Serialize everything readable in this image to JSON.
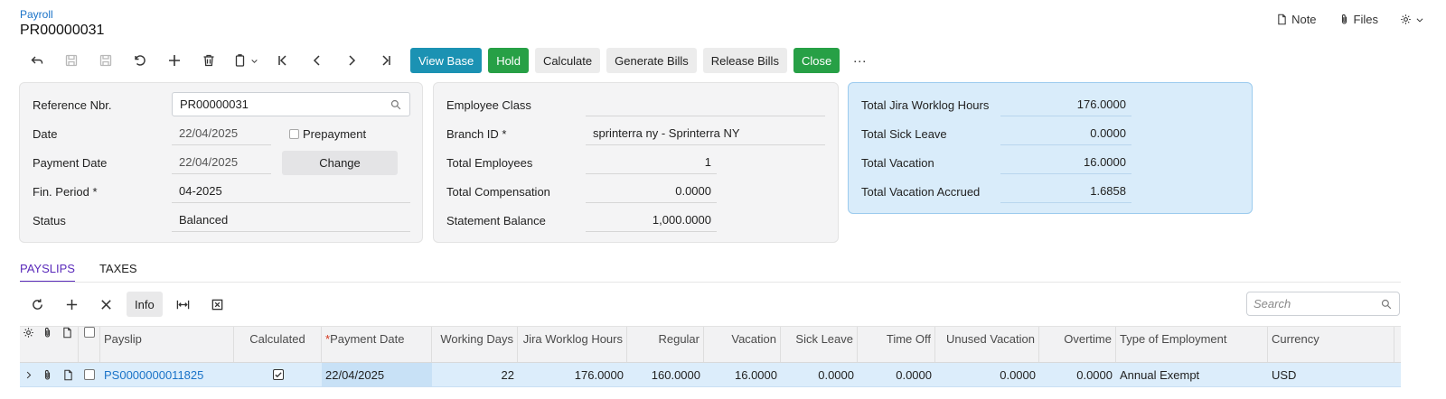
{
  "header": {
    "breadcrumb": "Payroll",
    "title": "PR00000031",
    "note_label": "Note",
    "files_label": "Files"
  },
  "toolbar": {
    "view_base": "View Base",
    "hold": "Hold",
    "calculate": "Calculate",
    "generate_bills": "Generate Bills",
    "release_bills": "Release Bills",
    "close": "Close",
    "more": "···"
  },
  "summary": {
    "reference_nbr_label": "Reference Nbr.",
    "reference_nbr": "PR00000031",
    "date_label": "Date",
    "date": "22/04/2025",
    "prepayment_label": "Prepayment",
    "payment_date_label": "Payment Date",
    "payment_date": "22/04/2025",
    "change_label": "Change",
    "fin_period_label": "Fin. Period",
    "fin_period": "04-2025",
    "status_label": "Status",
    "status": "Balanced"
  },
  "employee": {
    "employee_class_label": "Employee Class",
    "employee_class": "",
    "branch_id_label": "Branch ID",
    "branch_id": "sprinterra ny - Sprinterra NY",
    "total_employees_label": "Total Employees",
    "total_employees": "1",
    "total_compensation_label": "Total Compensation",
    "total_compensation": "0.0000",
    "statement_balance_label": "Statement Balance",
    "statement_balance": "1,000.0000"
  },
  "totals": {
    "jira_hours_label": "Total Jira Worklog Hours",
    "jira_hours": "176.0000",
    "sick_leave_label": "Total Sick Leave",
    "sick_leave": "0.0000",
    "vacation_label": "Total Vacation",
    "vacation": "16.0000",
    "vacation_accrued_label": "Total Vacation Accrued",
    "vacation_accrued": "1.6858"
  },
  "tabs": [
    "PAYSLIPS",
    "TAXES"
  ],
  "grid": {
    "info_label": "Info",
    "search_placeholder": "Search",
    "columns": {
      "payslip": "Payslip",
      "calculated": "Calculated",
      "payment_date": "Payment Date",
      "working_days": "Working Days",
      "jira_hours": "Jira Worklog Hours",
      "regular": "Regular",
      "vacation": "Vacation",
      "sick_leave": "Sick Leave",
      "time_off": "Time Off",
      "unused_vacation": "Unused Vacation",
      "overtime": "Overtime",
      "type_of_employment": "Type of Employment",
      "currency": "Currency"
    },
    "rows": [
      {
        "payslip": "PS0000000011825",
        "calculated": true,
        "payment_date": "22/04/2025",
        "working_days": "22",
        "jira_hours": "176.0000",
        "regular": "160.0000",
        "vacation": "16.0000",
        "sick_leave": "0.0000",
        "time_off": "0.0000",
        "unused_vacation": "0.0000",
        "overtime": "0.0000",
        "type_of_employment": "Annual Exempt",
        "currency": "USD"
      }
    ]
  }
}
